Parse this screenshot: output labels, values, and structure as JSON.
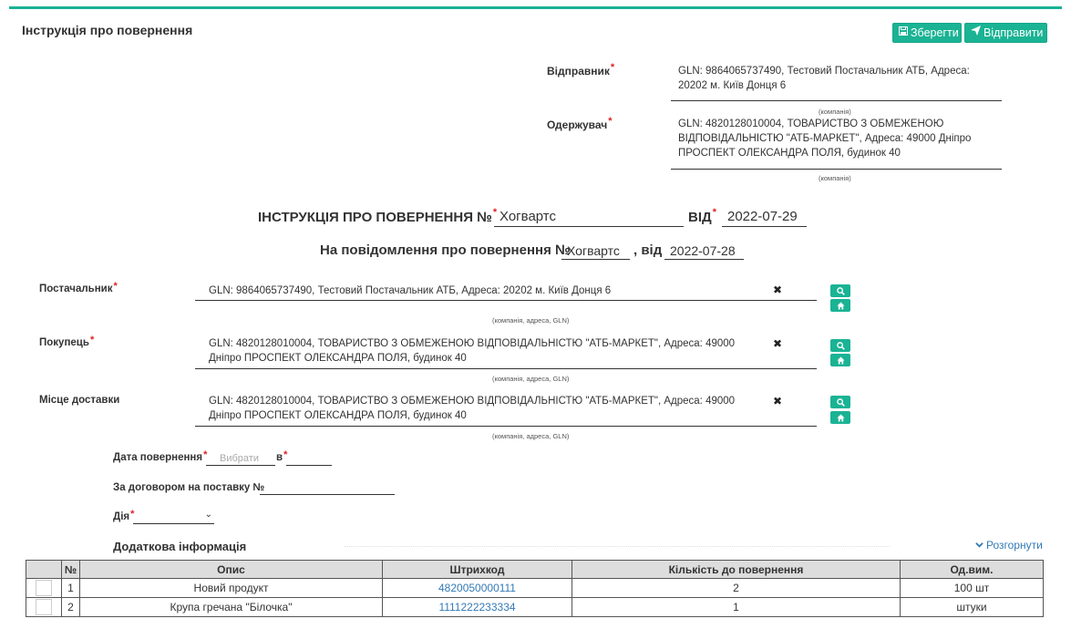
{
  "header": {
    "title": "Інструкція про повернення",
    "save_label": "Зберегти",
    "send_label": "Відправити"
  },
  "sender": {
    "label": "Відправник",
    "value": "GLN: 9864065737490, Тестовий Постачальник АТБ, Адреса: 20202 м. Київ Донця 6",
    "hint": "(компанія)"
  },
  "receiver": {
    "label": "Одержувач",
    "value": "GLN: 4820128010004, ТОВАРИСТВО З ОБМЕЖЕНОЮ ВІДПОВІДАЛЬНІСТЮ \"АТБ-МАРКЕТ\", Адреса: 49000 Дніпро ПРОСПЕКТ ОЛЕКСАНДРА ПОЛЯ, будинок 40",
    "hint": "(компанія)"
  },
  "document": {
    "title_label": "ІНСТРУКЦІЯ ПРО ПОВЕРНЕННЯ №",
    "number": "Хогвартс",
    "date_label": "ВІД",
    "date": "2022-07-29"
  },
  "notice": {
    "label": "На повідомлення про повернення №",
    "number": "Хогвартс",
    "date_label": ", від",
    "date": "2022-07-28"
  },
  "counterparties": [
    {
      "label": "Постачальник",
      "required": true,
      "value": "GLN: 9864065737490, Тестовий Постачальник АТБ, Адреса: 20202 м. Київ Донця 6",
      "hint": "(компанія, адреса, GLN)"
    },
    {
      "label": "Покупець",
      "required": true,
      "value": "GLN: 4820128010004, ТОВАРИСТВО З ОБМЕЖЕНОЮ ВІДПОВІДАЛЬНІСТЮ \"АТБ-МАРКЕТ\", Адреса: 49000 Дніпро ПРОСПЕКТ ОЛЕКСАНДРА ПОЛЯ, будинок 40",
      "hint": "(компанія, адреса, GLN)"
    },
    {
      "label": "Місце доставки",
      "required": false,
      "value": "GLN: 4820128010004, ТОВАРИСТВО З ОБМЕЖЕНОЮ ВІДПОВІДАЛЬНІСТЮ \"АТБ-МАРКЕТ\", Адреса: 49000 Дніпро ПРОСПЕКТ ОЛЕКСАНДРА ПОЛЯ, будинок 40",
      "hint": "(компанія, адреса, GLN)"
    }
  ],
  "return_date": {
    "label": "Дата повернення",
    "placeholder": "Вибрати",
    "time_label": "в"
  },
  "contract": {
    "label": "За договором на поставку №",
    "value": ""
  },
  "action": {
    "label": "Дія",
    "value": ""
  },
  "additional": {
    "title": "Додаткова інформація",
    "expand_label": "Розгорнути"
  },
  "table": {
    "headers": [
      "",
      "№",
      "Опис",
      "Штрихкод",
      "Кількість до повернення",
      "Од.вим."
    ],
    "rows": [
      {
        "no": "1",
        "desc": "Новий продукт",
        "barcode": "4820050000111",
        "qty": "2",
        "unit": "100 шт"
      },
      {
        "no": "2",
        "desc": "Крупа гречана \"Білочка\"",
        "barcode": "1111222233334",
        "qty": "1",
        "unit": "штуки"
      }
    ]
  },
  "colors": {
    "accent": "#1ab394",
    "link": "#337ab7",
    "required": "#e02020"
  }
}
